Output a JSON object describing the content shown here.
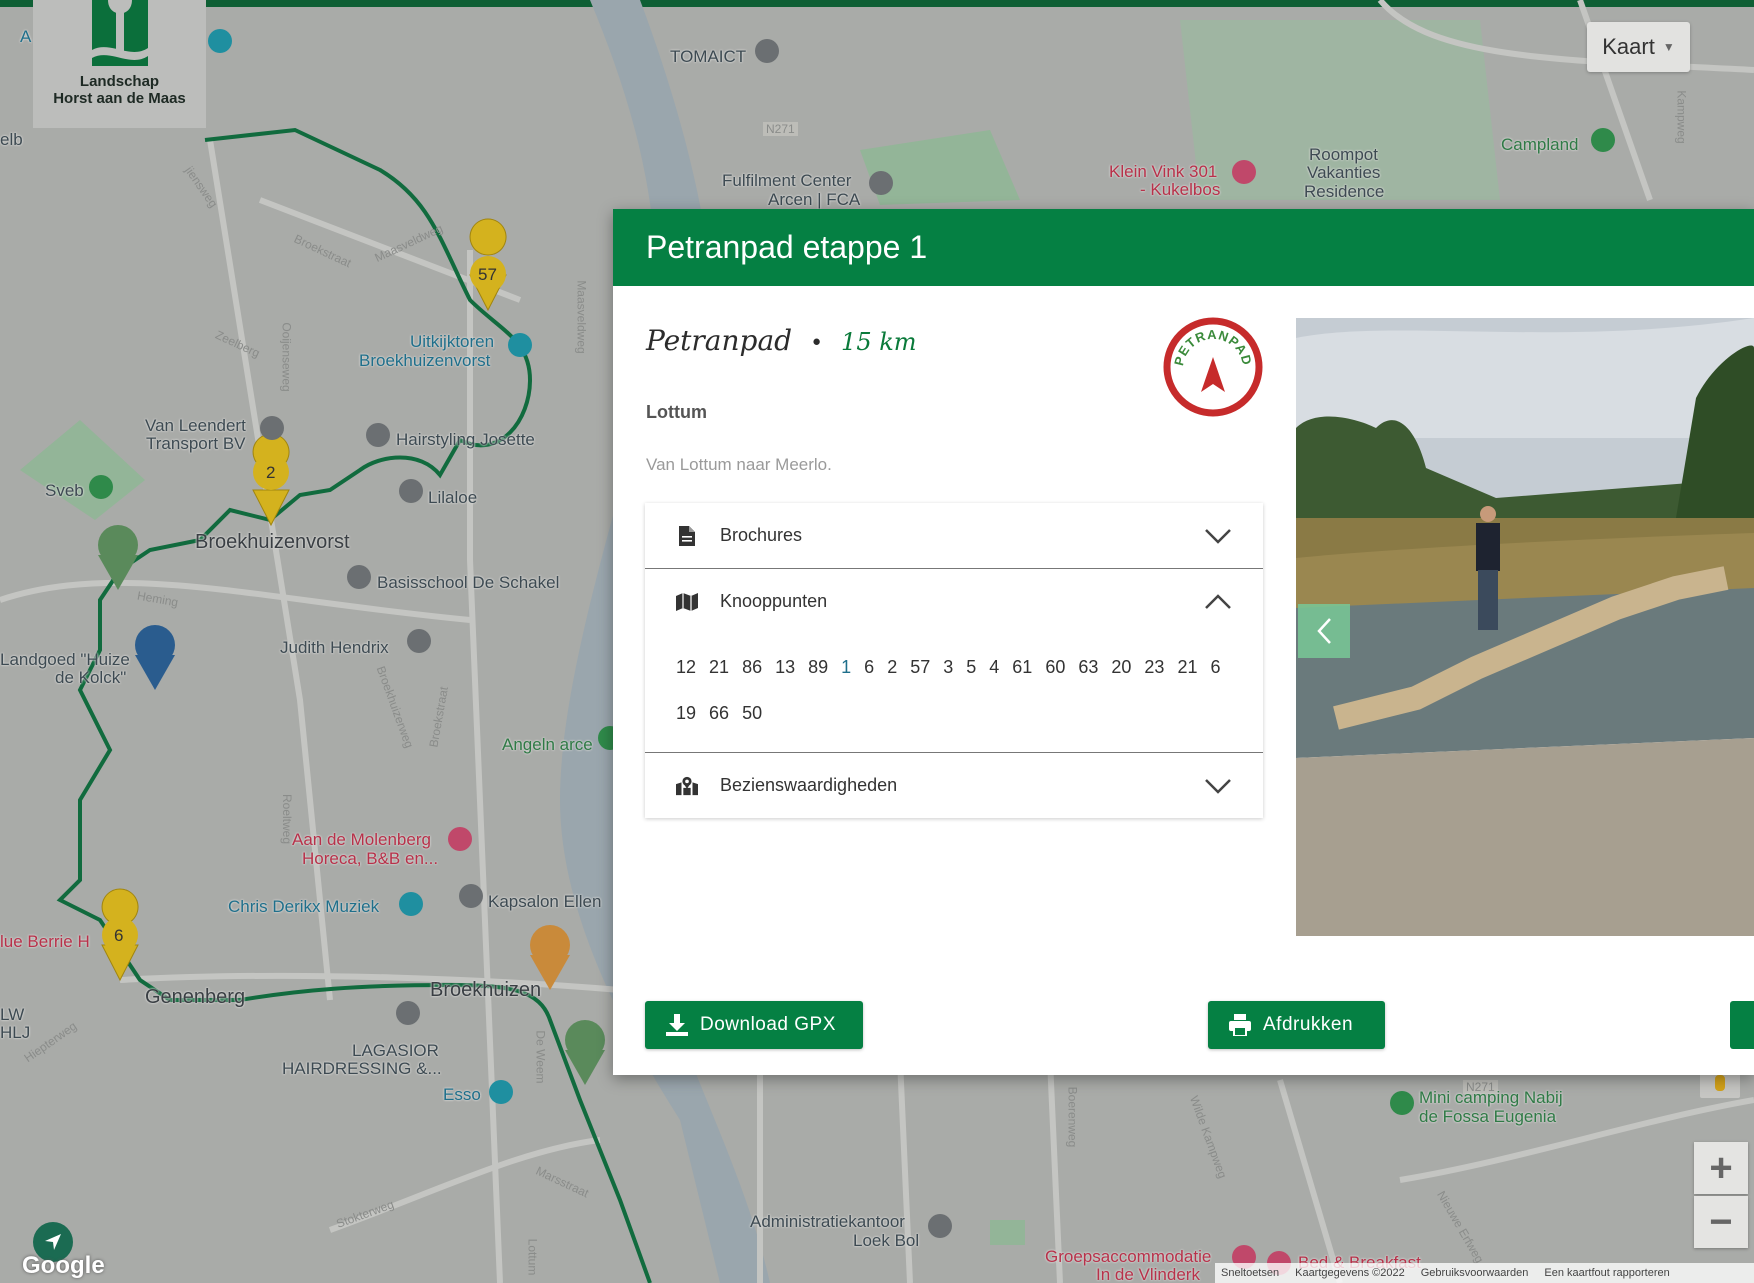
{
  "colors": {
    "brand_green": "#058043",
    "route_green": "#116b3e",
    "marker_yellow": "#d4b21e"
  },
  "logo": {
    "name_line1": "Landschap",
    "name_line2": "Horst aan de Maas"
  },
  "map": {
    "type_label": "Kaart",
    "places": [
      {
        "text": "TOMAICT",
        "style": ""
      },
      {
        "text": "Fulfilment Center",
        "style": ""
      },
      {
        "text": "Arcen | FCA",
        "style": ""
      },
      {
        "text": "Klein Vink 301",
        "style": "red"
      },
      {
        "text": "- Kukelbos",
        "style": "red"
      },
      {
        "text": "Roompot",
        "style": ""
      },
      {
        "text": "Vakanties",
        "style": ""
      },
      {
        "text": "Residence",
        "style": ""
      },
      {
        "text": "Campland",
        "style": "green"
      },
      {
        "text": "Uitkijktoren",
        "style": "teal"
      },
      {
        "text": "Broekhuizenvorst",
        "style": "teal"
      },
      {
        "text": "Van Leendert",
        "style": ""
      },
      {
        "text": "Transport BV",
        "style": ""
      },
      {
        "text": "Hairstyling Josette",
        "style": ""
      },
      {
        "text": "Lilaloe",
        "style": ""
      },
      {
        "text": "Sveb",
        "style": ""
      },
      {
        "text": "Broekhuizenvorst",
        "style": "big"
      },
      {
        "text": "Basisschool De Schakel",
        "style": ""
      },
      {
        "text": "Landgoed \"Huize",
        "style": ""
      },
      {
        "text": "de Kolck\"",
        "style": ""
      },
      {
        "text": "Judith Hendrix",
        "style": ""
      },
      {
        "text": "Angeln arce",
        "style": "green"
      },
      {
        "text": "Aan de Molenberg",
        "style": "red"
      },
      {
        "text": "Horeca, B&B en...",
        "style": "red"
      },
      {
        "text": "Chris Derikx Muziek",
        "style": "teal"
      },
      {
        "text": "Kapsalon Ellen",
        "style": ""
      },
      {
        "text": "lue Berrie H",
        "style": "red"
      },
      {
        "text": "Genenberg",
        "style": "big"
      },
      {
        "text": "Broekhuizen",
        "style": "big"
      },
      {
        "text": "LAGASIOR",
        "style": ""
      },
      {
        "text": "HAIRDRESSING &...",
        "style": ""
      },
      {
        "text": "Esso",
        "style": "teal"
      },
      {
        "text": "LW",
        "style": ""
      },
      {
        "text": "HLJ",
        "style": ""
      },
      {
        "text": "Mini camping Nabij",
        "style": "green"
      },
      {
        "text": "de Fossa Eugenia",
        "style": "green"
      },
      {
        "text": "Administratiekantoor",
        "style": ""
      },
      {
        "text": "Loek Bol",
        "style": ""
      },
      {
        "text": "Groepsaccommodatie",
        "style": "red"
      },
      {
        "text": "In de Vlinderk",
        "style": "red"
      },
      {
        "text": "Bed & Breakfast",
        "style": "red"
      },
      {
        "text": "A",
        "style": "teal"
      },
      {
        "text": "elb",
        "style": ""
      }
    ],
    "streets": [
      "Broekstraat",
      "Maasveldweg",
      "Zeelberg",
      "Ooijenseweg",
      "Heming",
      "Broekstraat",
      "Broekhuizerweg",
      "Roeltweg",
      "Stokterweg",
      "Marsstraat",
      "Lottum",
      "De Weem",
      "Hiepterweg",
      "Maasveldweg",
      "Kampweg",
      "Boerenweg",
      "Wilde Kampweg",
      "Nieuwe Erfweg",
      "jiensweg",
      "N271",
      "N271"
    ],
    "markers": [
      "57",
      "2",
      "6"
    ],
    "footer": [
      "Sneltoetsen",
      "Kaartgegevens ©2022",
      "Gebruiksvoorwaarden",
      "Een kaartfout rapporteren"
    ],
    "google_label": "Google",
    "zoom_in": "+",
    "zoom_out": "−"
  },
  "modal": {
    "title": "Petranpad etappe 1",
    "route_name": "Petranpad",
    "separator": "•",
    "distance": "15 km",
    "place": "Lottum",
    "description": "Van Lottum naar Meerlo.",
    "badge_text": "PETRANPAD",
    "accordion": [
      {
        "label": "Brochures",
        "icon": "file-icon",
        "expanded": false
      },
      {
        "label": "Knooppunten",
        "icon": "map-icon",
        "expanded": true
      },
      {
        "label": "Bezienswaardigheden",
        "icon": "map-marked-icon",
        "expanded": false
      }
    ],
    "knooppunten": [
      "12",
      "21",
      "86",
      "13",
      "89",
      "1",
      "6",
      "2",
      "57",
      "3",
      "5",
      "4",
      "61",
      "60",
      "63",
      "20",
      "23",
      "21",
      "6",
      "19",
      "66",
      "50"
    ],
    "buttons": {
      "download": "Download GPX",
      "print": "Afdrukken"
    }
  }
}
